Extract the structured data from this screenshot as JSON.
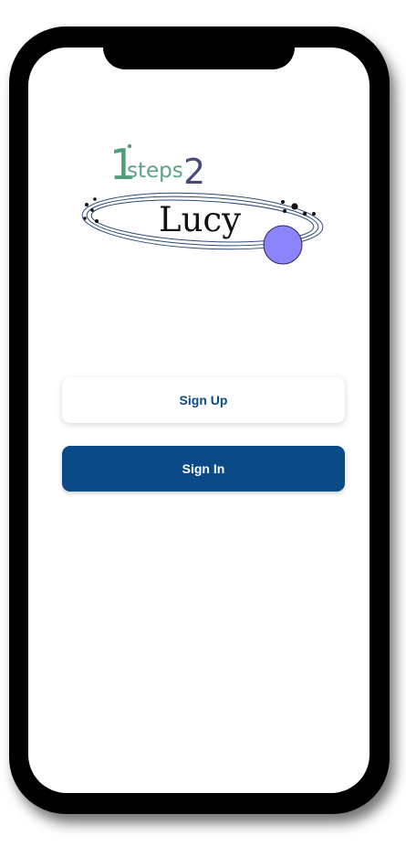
{
  "logo": {
    "digit": "1",
    "word": "steps",
    "number": "2",
    "name": "Lucy",
    "colors": {
      "one": "#4f9e7a",
      "steps": "#5fa088",
      "two": "#4b4a7c",
      "orbit": "#2b4a7a",
      "planet": "#8c84fb"
    }
  },
  "buttons": {
    "signup_label": "Sign Up",
    "signin_label": "Sign In"
  },
  "colors": {
    "primary": "#0a4a86",
    "phone_frame": "#000000",
    "screen": "#ffffff"
  }
}
